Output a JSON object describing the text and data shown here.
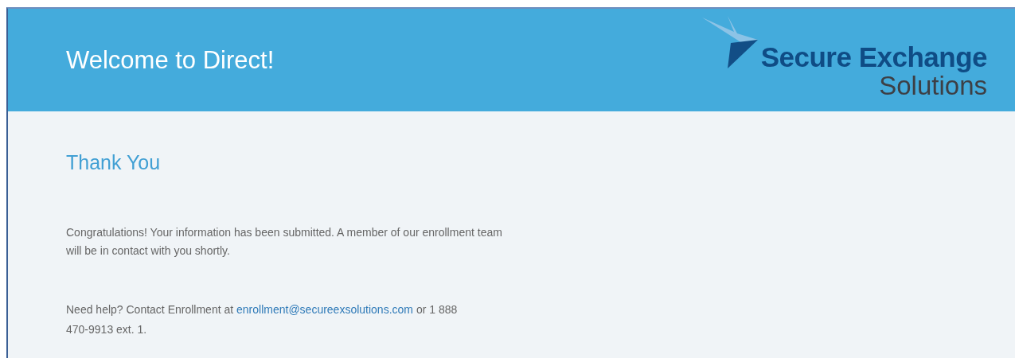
{
  "header": {
    "title": "Welcome to Direct!",
    "logo": {
      "line_1": "Secure Exchange",
      "line_2": "Solutions"
    }
  },
  "content": {
    "heading": "Thank You",
    "message": "Congratulations! Your information has been submitted. A member of our enrollment team will be in contact with you shortly.",
    "help": {
      "before": "Need help? Contact Enrollment at ",
      "link": "enrollment@secureexsolutions.com",
      "after": " or 1 888 470-9913 ext. 1."
    }
  }
}
